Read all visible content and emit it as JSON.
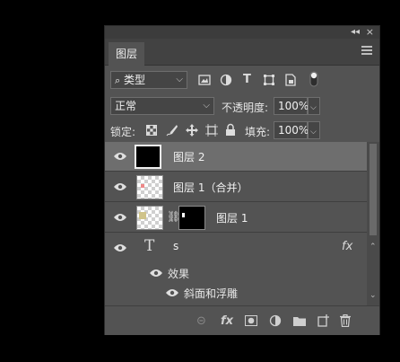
{
  "window": {
    "collapse_glyph": "◂◂",
    "close_glyph": "×"
  },
  "tabs": [
    {
      "label": "图层"
    }
  ],
  "filter": {
    "icon": "search-icon",
    "label": "类型"
  },
  "blend": {
    "mode": "正常",
    "opacity_label": "不透明度:",
    "opacity_value": "100%"
  },
  "lock": {
    "label": "锁定:",
    "fill_label": "填充:",
    "fill_value": "100%"
  },
  "layers": [
    {
      "name": "图层 2",
      "selected": true
    },
    {
      "name": "图层 1（合并）",
      "selected": false
    },
    {
      "name": "图层 1",
      "selected": false,
      "has_mask": true
    },
    {
      "name": "s",
      "type": "text",
      "fx": "fx"
    }
  ],
  "effects": {
    "label": "效果",
    "items": [
      "斜面和浮雕"
    ]
  },
  "bottom_icons": [
    "link-icon",
    "fx-icon",
    "mask-icon",
    "adjustment-icon",
    "folder-icon",
    "new-layer-icon",
    "trash-icon"
  ],
  "colors": {
    "panel": "#535353",
    "selected_row": "#6e6e6e",
    "background": "#000000"
  }
}
